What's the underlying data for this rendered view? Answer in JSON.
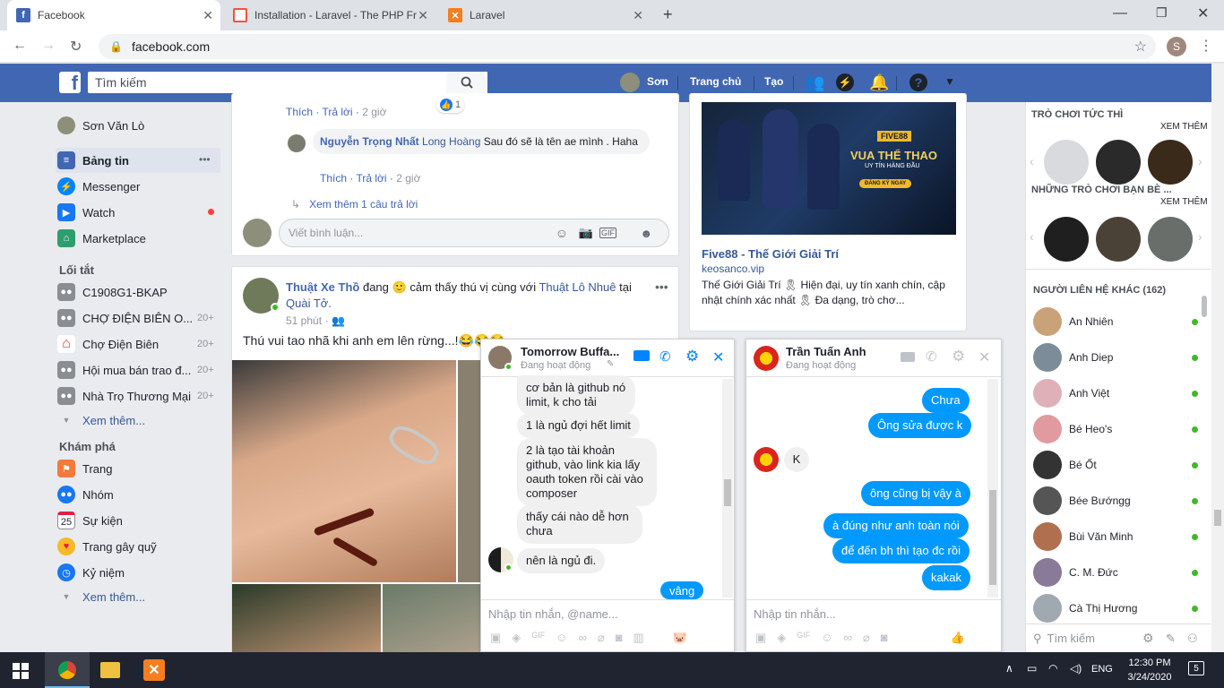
{
  "browser": {
    "tabs": [
      {
        "title": "Facebook",
        "active": true
      },
      {
        "title": "Installation - Laravel - The PHP Fr",
        "active": false
      },
      {
        "title": "Laravel",
        "active": false
      }
    ],
    "url": "facebook.com",
    "profile_initial": "S"
  },
  "fb": {
    "logo": "f",
    "search_placeholder": "Tìm kiếm",
    "user_name": "Sơn",
    "home": "Trang chủ",
    "create": "Tạo"
  },
  "left": {
    "profile": "Sơn Văn Lò",
    "main": [
      {
        "label": "Bảng tin",
        "more": "•••"
      },
      {
        "label": "Messenger"
      },
      {
        "label": "Watch"
      },
      {
        "label": "Marketplace"
      }
    ],
    "shortcuts_title": "Lối tắt",
    "shortcuts": [
      {
        "label": "C1908G1-BKAP",
        "count": ""
      },
      {
        "label": "CHỢ ĐIỆN BIÊN O...",
        "count": "20+"
      },
      {
        "label": "Chợ Điện Biên",
        "count": "20+"
      },
      {
        "label": "Hội mua bán trao đ...",
        "count": "20+"
      },
      {
        "label": "Nhà Trọ Thương Mại",
        "count": "20+"
      }
    ],
    "see_more_1": "Xem thêm...",
    "explore_title": "Khám phá",
    "explore": [
      {
        "label": "Trang"
      },
      {
        "label": "Nhóm"
      },
      {
        "label": "Sự kiện",
        "icon_text": "25"
      },
      {
        "label": "Trang gây quỹ"
      },
      {
        "label": "Kỷ niệm"
      }
    ],
    "see_more_2": "Xem thêm..."
  },
  "feed": {
    "post1": {
      "like": "Thích",
      "reply": "Trả lời",
      "time": "2 giờ",
      "reaction_count": "1",
      "comment_author": "Nguyễn Trọng Nhất",
      "comment_mention": "Long Hoàng",
      "comment_text": "Sau đó sẽ là tên ae mình . Haha",
      "like2": "Thích",
      "reply2": "Trả lời",
      "time2": "2 giờ",
      "more_replies": "Xem thêm 1 câu trả lời",
      "comment_placeholder": "Viết bình luận..."
    },
    "post2": {
      "author": "Thuật Xe Thồ",
      "verb": "đang",
      "feeling": "cảm thấy thú vị cùng với",
      "tagged": "Thuật Lô Nhuê",
      "at": "tại",
      "place": "Quài Tở.",
      "time": "51 phút",
      "text": "Thú vui tao nhã khi anh em lên rừng...!😂😂😂",
      "more": "•••"
    }
  },
  "ad": {
    "banner_brand": "FIVE88",
    "banner_title": "VUA THỂ THAO",
    "banner_sub": "UY TÍN HÀNG ĐẦU",
    "banner_btn": "ĐĂNG KÝ NGAY",
    "title": "Five88 - Thế Giới Giải Trí",
    "domain": "keosanco.vip",
    "desc": "Thế Giới Giải Trí 🎗 Hiện đại, uy tín xanh chín, cập nhật chính xác nhất 🎗 Đa dạng, trò chơ..."
  },
  "chat1": {
    "name": "Tomorrow Buffa...",
    "status": "Đang hoạt động",
    "messages": [
      {
        "text": "cơ bản là github nó limit, k cho tải",
        "out": false
      },
      {
        "text": "1 là ngủ đợi hết limit",
        "out": false
      },
      {
        "text": "2 là tạo tài khoản github, vào link kia lấy oauth token rồi cài vào composer",
        "out": false
      },
      {
        "text": "thấy cái nào dễ hơn chưa",
        "out": false
      },
      {
        "text": "nên là ngủ đi.",
        "out": false
      },
      {
        "text": "vâng",
        "out": true
      }
    ],
    "input_placeholder": "Nhập tin nhắn, @name..."
  },
  "chat2": {
    "name": "Trần Tuấn Anh",
    "status": "Đang hoạt động",
    "messages": [
      {
        "text": "Chưa",
        "out": true
      },
      {
        "text": "Ông sửa được k",
        "out": true
      },
      {
        "text": "K",
        "out": false
      },
      {
        "text": "ông cũng bị vậy à",
        "out": true
      },
      {
        "text": "à đúng như anh toàn nói",
        "out": true
      },
      {
        "text": "để đến bh thì tạo đc rồi",
        "out": true
      },
      {
        "text": "kakak",
        "out": true
      }
    ],
    "input_placeholder": "Nhập tin nhắn..."
  },
  "right": {
    "games_title": "TRÒ CHƠI TỨC THÌ",
    "see_more": "XEM THÊM",
    "friends_games_title": "NHỮNG TRÒ CHƠI BẠN BÈ ...",
    "see_more2": "XEM THÊM",
    "contacts_title": "NGƯỜI LIÊN HỆ KHÁC (162)",
    "contacts": [
      {
        "name": "An Nhiên",
        "color": "#c9a27a"
      },
      {
        "name": "Anh Diep",
        "color": "#7d8c99"
      },
      {
        "name": "Anh Việt",
        "color": "#e0b0b8"
      },
      {
        "name": "Bé Heo's",
        "color": "#e09aa0"
      },
      {
        "name": "Bé Ốt",
        "color": "#333333"
      },
      {
        "name": "Bée Bướngg",
        "color": "#555555"
      },
      {
        "name": "Bùi Văn Minh",
        "color": "#b07050"
      },
      {
        "name": "C. M. Đức",
        "color": "#8a7a9a"
      },
      {
        "name": "Cà Thị Hương",
        "color": "#a0a8b0"
      }
    ],
    "search_placeholder": "Tìm kiếm"
  },
  "taskbar": {
    "lang": "ENG",
    "time": "12:30 PM",
    "date": "3/24/2020",
    "notif_count": "5"
  }
}
